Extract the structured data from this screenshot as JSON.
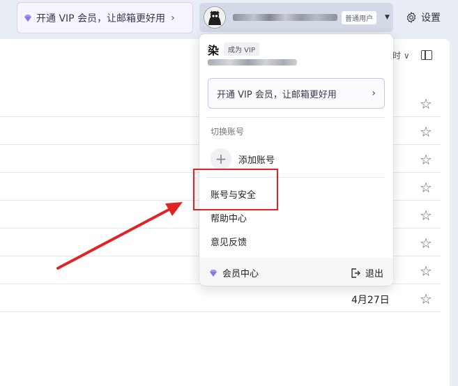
{
  "topbar": {
    "vip_banner_text": "开通 VIP 会员，让邮箱更好用",
    "user_tag": "普通用户",
    "settings_label": "设置"
  },
  "main": {
    "sort_label": "时",
    "rows": [
      {
        "date": ""
      },
      {
        "date": ""
      },
      {
        "date": ""
      },
      {
        "date": ""
      },
      {
        "date": ""
      },
      {
        "date": ""
      },
      {
        "date": ""
      },
      {
        "date": "4月27日"
      }
    ]
  },
  "dropdown": {
    "name": "染",
    "vip_tag": "成为 VIP",
    "vip_button_text": "开通 VIP 会员，让邮箱更好用",
    "switch_title": "切换账号",
    "add_account": "添加账号",
    "items": {
      "account_security": "账号与安全",
      "help_center": "帮助中心",
      "feedback": "意见反馈"
    },
    "footer": {
      "member_center": "会员中心",
      "logout": "退出"
    }
  },
  "colors": {
    "accent_purple": "#8a74e8",
    "annotation_red": "#e02424"
  }
}
